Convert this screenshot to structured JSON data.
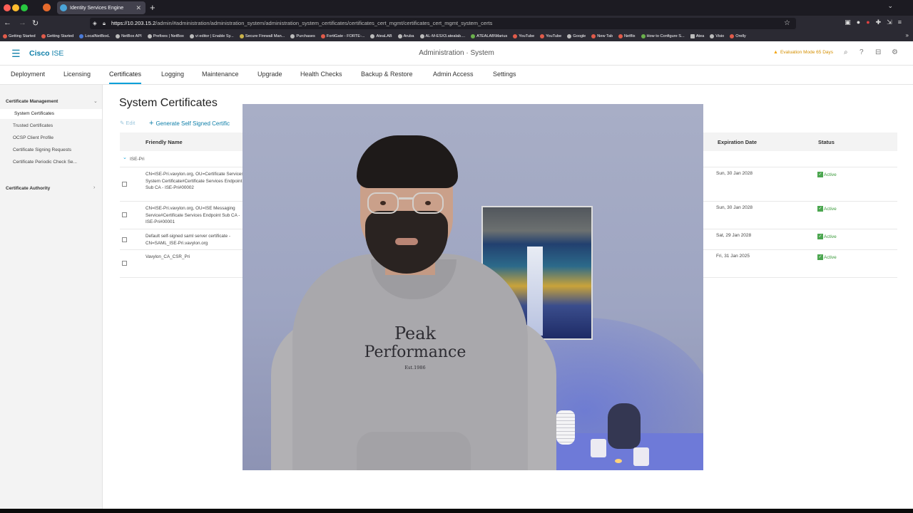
{
  "browser": {
    "tab_title": "Identity Services Engine",
    "url_host": "https://10.203.15.2",
    "url_path": "/admin/#administration/administration_system/administration_system_certificates/certificates_cert_mgmt/certificates_cert_mgmt_system_certs",
    "bookmarks": [
      "Getting Started",
      "Getting Started",
      "LocalNetBoxL",
      "NetBox API",
      "Prefixes | NetBox",
      "vi editor | Enable Sy...",
      "Secure Firewall Man...",
      "Purchases",
      "FortiGate - FORTE-...",
      "AteaLAB",
      "Aruba",
      "AL-M-ESX3.atealab....",
      "ATEALAB\\Marius",
      "YouTube",
      "YouTube",
      "Google",
      "New Tab",
      "Netflix",
      "How to Configure S...",
      "Atea",
      "Visio",
      "Orelly"
    ]
  },
  "header": {
    "brand_bold": "Cisco",
    "brand_light": "ISE",
    "page_title": "Administration · System",
    "eval_notice": "Evaluation Mode 65 Days"
  },
  "tabs": [
    "Deployment",
    "Licensing",
    "Certificates",
    "Logging",
    "Maintenance",
    "Upgrade",
    "Health Checks",
    "Backup & Restore",
    "Admin Access",
    "Settings"
  ],
  "active_tab": "Certificates",
  "sidebar": {
    "section1": "Certificate Management",
    "items": [
      "System Certificates",
      "Trusted Certificates",
      "OCSP Client Profile",
      "Certificate Signing Requests",
      "Certificate Periodic Check Se..."
    ],
    "section2": "Certificate Authority"
  },
  "content": {
    "title": "System Certificates",
    "edit": "Edit",
    "generate": "Generate Self Signed Certific",
    "columns": {
      "friendly_name": "Friendly Name",
      "expiration": "Expiration Date",
      "status": "Status"
    },
    "group": "ISE-Pri",
    "rows": [
      {
        "name": "CN=ISE-Pri.vavylon.org, OU=Certificate Services System Certificate#Certificate Services Endpoint Sub CA - ISE-Pri#00002",
        "expiration": "Sun, 30 Jan 2028",
        "status": "Active"
      },
      {
        "name": "CN=ISE-Pri.vavylon.org, OU=ISE Messaging Service#Certificate Services Endpoint Sub CA - ISE-Pri#00001",
        "expiration": "Sun, 30 Jan 2028",
        "status": "Active"
      },
      {
        "name": "Default self-signed saml server certificate - CN=SAML_ISE-Pri.vavylon.org",
        "expiration": "Sat, 29 Jan 2028",
        "status": "Active"
      },
      {
        "name": "Vavylon_CA_CSR_Pri",
        "expiration": "Fri, 31 Jan 2025",
        "status": "Active"
      }
    ]
  },
  "webcam": {
    "sweatshirt_line1": "Peak",
    "sweatshirt_line2": "Performance",
    "sweatshirt_line3": "Est.1986"
  }
}
